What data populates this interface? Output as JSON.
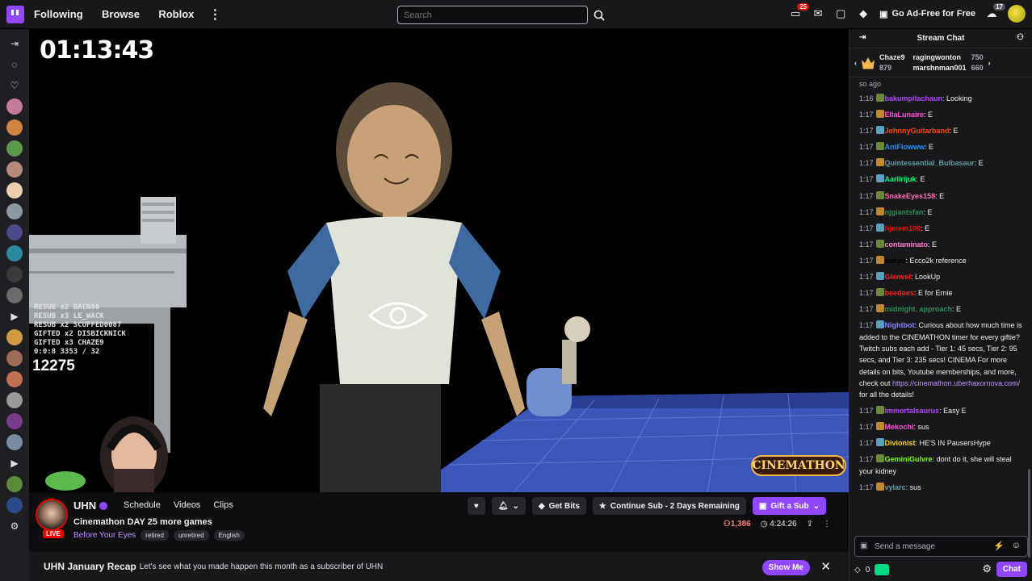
{
  "nav": {
    "following": "Following",
    "browse": "Browse",
    "roblox": "Roblox",
    "more": "⋮"
  },
  "search": {
    "placeholder": "Search"
  },
  "top_right": {
    "notif_count": "25",
    "gift_count": "17",
    "ad_free": "Go Ad-Free for Free"
  },
  "player": {
    "timer": "01:13:43",
    "overlay_lines": [
      "RESUB x2 BACN00",
      "RESUB x3 LE_WACK",
      "RESUB x2 SCUFFED0087",
      "GIFTED x2 DISBICKNICK",
      "GIFTED x3 CHAZE9",
      "0:0:8 3353 / 32"
    ],
    "counter": "12275",
    "logo_text": "CINEMATHON"
  },
  "channel": {
    "name": "UHN",
    "live": "LIVE",
    "tabs": [
      "Schedule",
      "Videos",
      "Clips"
    ],
    "title": "Cinemathon DAY 25 more games",
    "game": "Before Your Eyes",
    "tags": [
      "retired",
      "unretired",
      "English"
    ],
    "get_bits": "Get Bits",
    "continue_sub": "Continue Sub - 2 Days Remaining",
    "gift_sub": "Gift a Sub",
    "viewers": "1,386",
    "uptime": "4:24:26"
  },
  "recap": {
    "title": "UHN January Recap",
    "text": "Let's see what you made happen this month as a subscriber of UHN",
    "button": "Show Me"
  },
  "chat": {
    "header": "Stream Chat",
    "leader": {
      "u1": "Chaze9",
      "v1": "879",
      "u2": "ragingwonton",
      "v2": "750",
      "u3": "marshnman001",
      "v3": "660"
    },
    "so_ago": "so ago",
    "messages": [
      {
        "t": "1:16",
        "u": "bakumpitachaun",
        "c": "#b146ff",
        "m": ": Looking"
      },
      {
        "t": "1:17",
        "u": "EllaLunaire",
        "c": "#ff4fd8",
        "m": ": E"
      },
      {
        "t": "1:17",
        "u": "JohnnyGuitarband",
        "c": "#ff4500",
        "m": ": E"
      },
      {
        "t": "1:17",
        "u": "AntFlowww",
        "c": "#1e90ff",
        "m": ": E"
      },
      {
        "t": "1:17",
        "u": "Quintessential_Bulbasaur",
        "c": "#5f9ea0",
        "m": ": E"
      },
      {
        "t": "1:17",
        "u": "Aarlirijuk",
        "c": "#00ff7f",
        "m": ": E"
      },
      {
        "t": "1:17",
        "u": "SnakeEyes158",
        "c": "#ff69b4",
        "m": ": E"
      },
      {
        "t": "1:17",
        "u": "njgiantsfan",
        "c": "#2e8b57",
        "m": ": E"
      },
      {
        "t": "1:17",
        "u": "hjerem100",
        "c": "#ff0000",
        "m": ": E"
      },
      {
        "t": "1:17",
        "u": "contaminato",
        "c": "#ff7fd6",
        "m": ": E"
      },
      {
        "t": "1:17",
        "u": "nakyo",
        "c": "#000000",
        "m": ": Ecco2k reference"
      },
      {
        "t": "1:17",
        "u": "Glenvel",
        "c": "#ff2020",
        "m": ": LookUp"
      },
      {
        "t": "1:17",
        "u": "beedoes",
        "c": "#ff2020",
        "m": ": E for Ernie"
      },
      {
        "t": "1:17",
        "u": "midnight_approach",
        "c": "#2e8b57",
        "m": ": E"
      },
      {
        "t": "1:17",
        "u": "Nightbot",
        "c": "#8a80ff",
        "m": ": Curious about how much time is added to the CINEMATHON timer for every giftie? Twitch subs each add - Tier 1: 45 secs, Tier 2: 95 secs, and Tier 3: 235 secs! CINEMA For more details on bits, Youtube memberships, and more, check out",
        "link": "https://cinemathon.uberhaxornova.com/",
        "after": " for all the details!"
      },
      {
        "t": "1:17",
        "u": "immortalsaurus",
        "c": "#b146ff",
        "m": ": Easy E"
      },
      {
        "t": "1:17",
        "u": "Mekochi",
        "c": "#ff4fd8",
        "m": ": sus"
      },
      {
        "t": "1:17",
        "u": "Divionist",
        "c": "#ffd700",
        "m": ": HE'S IN PausersHype"
      },
      {
        "t": "1:17",
        "u": "GeminiGulvre",
        "c": "#7cfc00",
        "m": ": dont do it, she will steal your kidney"
      },
      {
        "t": "1:17",
        "u": "vylarc",
        "c": "#5f9ea0",
        "m": ": sus"
      }
    ],
    "input_placeholder": "Send a message",
    "points": "0",
    "chat_button": "Chat"
  },
  "colors": {
    "accent": "#9146ff",
    "live": "#eb0400",
    "bg": "#0e0e10"
  }
}
